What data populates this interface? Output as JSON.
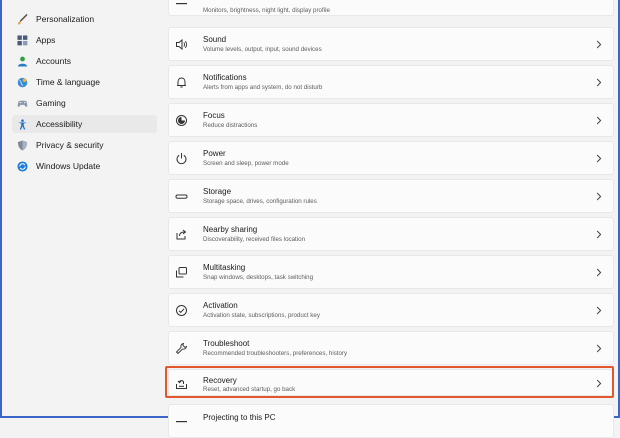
{
  "sidebar": {
    "items": [
      {
        "label": "Personalization",
        "icon": "brush-icon"
      },
      {
        "label": "Apps",
        "icon": "apps-icon"
      },
      {
        "label": "Accounts",
        "icon": "person-icon"
      },
      {
        "label": "Time & language",
        "icon": "globe-clock-icon"
      },
      {
        "label": "Gaming",
        "icon": "gamepad-icon"
      },
      {
        "label": "Accessibility",
        "icon": "accessibility-icon"
      },
      {
        "label": "Privacy & security",
        "icon": "shield-icon"
      },
      {
        "label": "Windows Update",
        "icon": "update-icon"
      }
    ],
    "active_index": 5
  },
  "settings": [
    {
      "title": "",
      "desc": "Monitors, brightness, night light, display profile",
      "icon": "display-icon"
    },
    {
      "title": "Sound",
      "desc": "Volume levels, output, input, sound devices",
      "icon": "speaker-icon"
    },
    {
      "title": "Notifications",
      "desc": "Alerts from apps and system, do not disturb",
      "icon": "bell-icon"
    },
    {
      "title": "Focus",
      "desc": "Reduce distractions",
      "icon": "focus-icon"
    },
    {
      "title": "Power",
      "desc": "Screen and sleep, power mode",
      "icon": "power-icon"
    },
    {
      "title": "Storage",
      "desc": "Storage space, drives, configuration rules",
      "icon": "storage-icon"
    },
    {
      "title": "Nearby sharing",
      "desc": "Discoverability, received files location",
      "icon": "share-icon"
    },
    {
      "title": "Multitasking",
      "desc": "Snap windows, desktops, task switching",
      "icon": "multitask-icon"
    },
    {
      "title": "Activation",
      "desc": "Activation state, subscriptions, product key",
      "icon": "check-circle-icon"
    },
    {
      "title": "Troubleshoot",
      "desc": "Recommended troubleshooters, preferences, history",
      "icon": "wrench-icon"
    },
    {
      "title": "Recovery",
      "desc": "Reset, advanced startup, go back",
      "icon": "recovery-icon"
    },
    {
      "title": "Projecting to this PC",
      "desc": "",
      "icon": "project-icon"
    }
  ],
  "colors": {
    "highlight": "#e2572b",
    "frame": "#3b66c8",
    "accent": "#0067c0"
  }
}
